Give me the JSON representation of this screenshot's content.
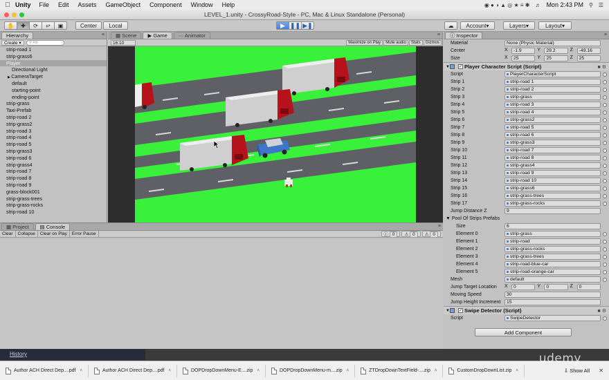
{
  "menubar": {
    "app": "Unity",
    "items": [
      "File",
      "Edit",
      "Assets",
      "GameObject",
      "Component",
      "Window",
      "Help"
    ],
    "clock": "Mon 2:43 PM"
  },
  "window": {
    "title": "LEVEL_1.unity - CrossyRoad-Style - PC, Mac & Linux Standalone (Personal)"
  },
  "toolbar": {
    "pivot": "Center",
    "space": "Local",
    "account": "Account",
    "layers": "Layers",
    "layout": "Layout"
  },
  "hierarchy": {
    "tab": "Hierarchy",
    "create": "Create",
    "search_placeholder": "All",
    "rows": [
      {
        "label": "strip-road 1",
        "child": false,
        "sel": false
      },
      {
        "label": "strip-grass6",
        "child": false,
        "sel": false
      },
      {
        "label": "Player",
        "child": false,
        "sel": true
      },
      {
        "label": "Directional Light",
        "child": true,
        "sel": false
      },
      {
        "label": "CameraTarget",
        "child": true,
        "sel": false
      },
      {
        "label": "default",
        "child": true,
        "sel": false
      },
      {
        "label": "starting-point",
        "child": true,
        "sel": false
      },
      {
        "label": "ending-point",
        "child": true,
        "sel": false
      },
      {
        "label": "strip-grass",
        "child": false,
        "sel": false
      },
      {
        "label": "Taxi-Prefab",
        "child": false,
        "sel": false
      },
      {
        "label": "strip-road 2",
        "child": false,
        "sel": false
      },
      {
        "label": "strip-grass2",
        "child": false,
        "sel": false
      },
      {
        "label": "strip-road 3",
        "child": false,
        "sel": false
      },
      {
        "label": "strip-road 4",
        "child": false,
        "sel": false
      },
      {
        "label": "strip-road 5",
        "child": false,
        "sel": false
      },
      {
        "label": "strip-grass3",
        "child": false,
        "sel": false
      },
      {
        "label": "strip-road 6",
        "child": false,
        "sel": false
      },
      {
        "label": "strip-grass4",
        "child": false,
        "sel": false
      },
      {
        "label": "strip-road 7",
        "child": false,
        "sel": false
      },
      {
        "label": "strip-road 8",
        "child": false,
        "sel": false
      },
      {
        "label": "strip-road 9",
        "child": false,
        "sel": false
      },
      {
        "label": "grass-block001",
        "child": false,
        "sel": false
      },
      {
        "label": "strip-grass-trees",
        "child": false,
        "sel": false
      },
      {
        "label": "strip-grass-rocks",
        "child": false,
        "sel": false
      },
      {
        "label": "strip-road 10",
        "child": false,
        "sel": false
      }
    ]
  },
  "center": {
    "tabs": [
      "Scene",
      "Game",
      "Animator"
    ],
    "aspect": "16:10",
    "options": [
      "Maximize on Play",
      "Mute audio",
      "Stats",
      "Gizmos"
    ]
  },
  "console": {
    "tabs": [
      "Project",
      "Console"
    ],
    "buttons": [
      "Clear",
      "Collapse",
      "Clear on Play",
      "Error Pause"
    ],
    "counts": [
      "0",
      "0",
      "0"
    ]
  },
  "inspector": {
    "tab": "Inspector",
    "material_label": "Material",
    "material_value": "None (Physic Material)",
    "center_label": "Center",
    "center": [
      "-1.9",
      "29.2",
      "-49.16"
    ],
    "size_label": "Size",
    "size": [
      "25",
      "25",
      "25"
    ],
    "player_script": {
      "header": "Player Character Script (Script)",
      "rows": [
        {
          "label": "Script",
          "value": "PlayerCharacterScript"
        },
        {
          "label": "Strip 1",
          "value": "strip-road 1"
        },
        {
          "label": "Strip 2",
          "value": "strip-road 2"
        },
        {
          "label": "Strip 3",
          "value": "strip-grass"
        },
        {
          "label": "Strip 4",
          "value": "strip-road 3"
        },
        {
          "label": "Strip 5",
          "value": "strip-road 4"
        },
        {
          "label": "Strip 6",
          "value": "strip-grass2"
        },
        {
          "label": "Strip 7",
          "value": "strip-road 5"
        },
        {
          "label": "Strip 8",
          "value": "strip-road 6"
        },
        {
          "label": "Strip 9",
          "value": "strip-grass3"
        },
        {
          "label": "Strip 10",
          "value": "strip-road 7"
        },
        {
          "label": "Strip 11",
          "value": "strip-road 8"
        },
        {
          "label": "Strip 12",
          "value": "strip-grass4"
        },
        {
          "label": "Strip 13",
          "value": "strip-road 9"
        },
        {
          "label": "Strip 14",
          "value": "strip-road 10"
        },
        {
          "label": "Strip 15",
          "value": "strip-grass6"
        },
        {
          "label": "Strip 16",
          "value": "strip-grass-trees"
        },
        {
          "label": "Strip 17",
          "value": "strip-grass-rocks"
        }
      ],
      "jump_distance_label": "Jump Distance Z",
      "jump_distance": "9",
      "pool_label": "Pool Of Strips Prefabs",
      "pool_size_label": "Size",
      "pool_size": "6",
      "elements": [
        {
          "label": "Element 0",
          "value": "strip-grass"
        },
        {
          "label": "Element 1",
          "value": "strip-road"
        },
        {
          "label": "Element 2",
          "value": "strip-grass-rocks"
        },
        {
          "label": "Element 3",
          "value": "strip-grass-trees"
        },
        {
          "label": "Element 4",
          "value": "strip-road-blue-car"
        },
        {
          "label": "Element 5",
          "value": "strip-road-orange-car"
        }
      ],
      "mesh_label": "Mesh",
      "mesh": "default",
      "jump_target_label": "Jump Target Location",
      "jump_target": [
        "0",
        "0",
        "0"
      ],
      "moving_speed_label": "Moving Speed",
      "moving_speed": "30",
      "jump_height_label": "Jump Height Increment",
      "jump_height": "15"
    },
    "swipe": {
      "header": "Swipe Detector (Script)",
      "script_label": "Script",
      "script": "SwipeDetector"
    },
    "add_component": "Add Component"
  },
  "browser": {
    "history": "History",
    "downloads": [
      "Author ACH Direct Dep....pdf",
      "Author ACH Direct Dep....pdf",
      "DOPDropDownMenu-E....zip",
      "DOPDropDownMenu-m....zip",
      "ZTDropDownTextField-....zip",
      "CustomDropDownList.zip"
    ],
    "show_all": "Show All",
    "watermark": "udemy"
  },
  "colors": {
    "grass": "#39f03a",
    "road": "#5f5f66",
    "truck_red": "#b5121b",
    "truck_white": "#eeeeee",
    "car_blue": "#3f76c9"
  }
}
